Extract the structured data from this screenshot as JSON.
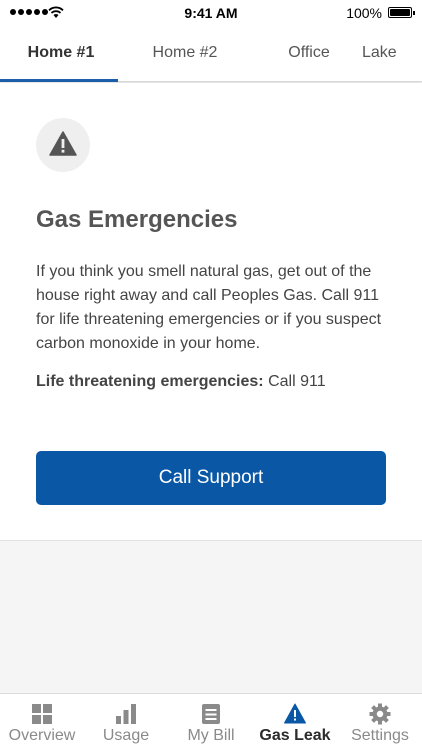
{
  "status_bar": {
    "time": "9:41 AM",
    "battery": "100%"
  },
  "tabs": [
    {
      "label": "Home #1",
      "active": true
    },
    {
      "label": "Home #2",
      "active": false
    },
    {
      "label": "Office",
      "active": false
    },
    {
      "label": "Lake",
      "active": false
    }
  ],
  "card": {
    "icon": "warning-icon",
    "title": "Gas Emergencies",
    "description": "If you think you smell natural gas, get out of the house right away and call Peoples Gas. Call 911 for life threatening emergencies or if you suspect carbon monoxide in your home.",
    "life_label": "Life threatening emergencies:",
    "life_value": " Call 911",
    "button_label": "Call Support"
  },
  "bottom_nav": [
    {
      "label": "Overview",
      "icon": "grid-icon",
      "active": false
    },
    {
      "label": "Usage",
      "icon": "bar-chart-icon",
      "active": false
    },
    {
      "label": "My Bill",
      "icon": "document-icon",
      "active": false
    },
    {
      "label": "Gas Leak",
      "icon": "warning-icon",
      "active": true
    },
    {
      "label": "Settings",
      "icon": "gear-icon",
      "active": false
    }
  ],
  "colors": {
    "accent": "#0a57a6",
    "tab_indicator": "#1c5fa8"
  }
}
